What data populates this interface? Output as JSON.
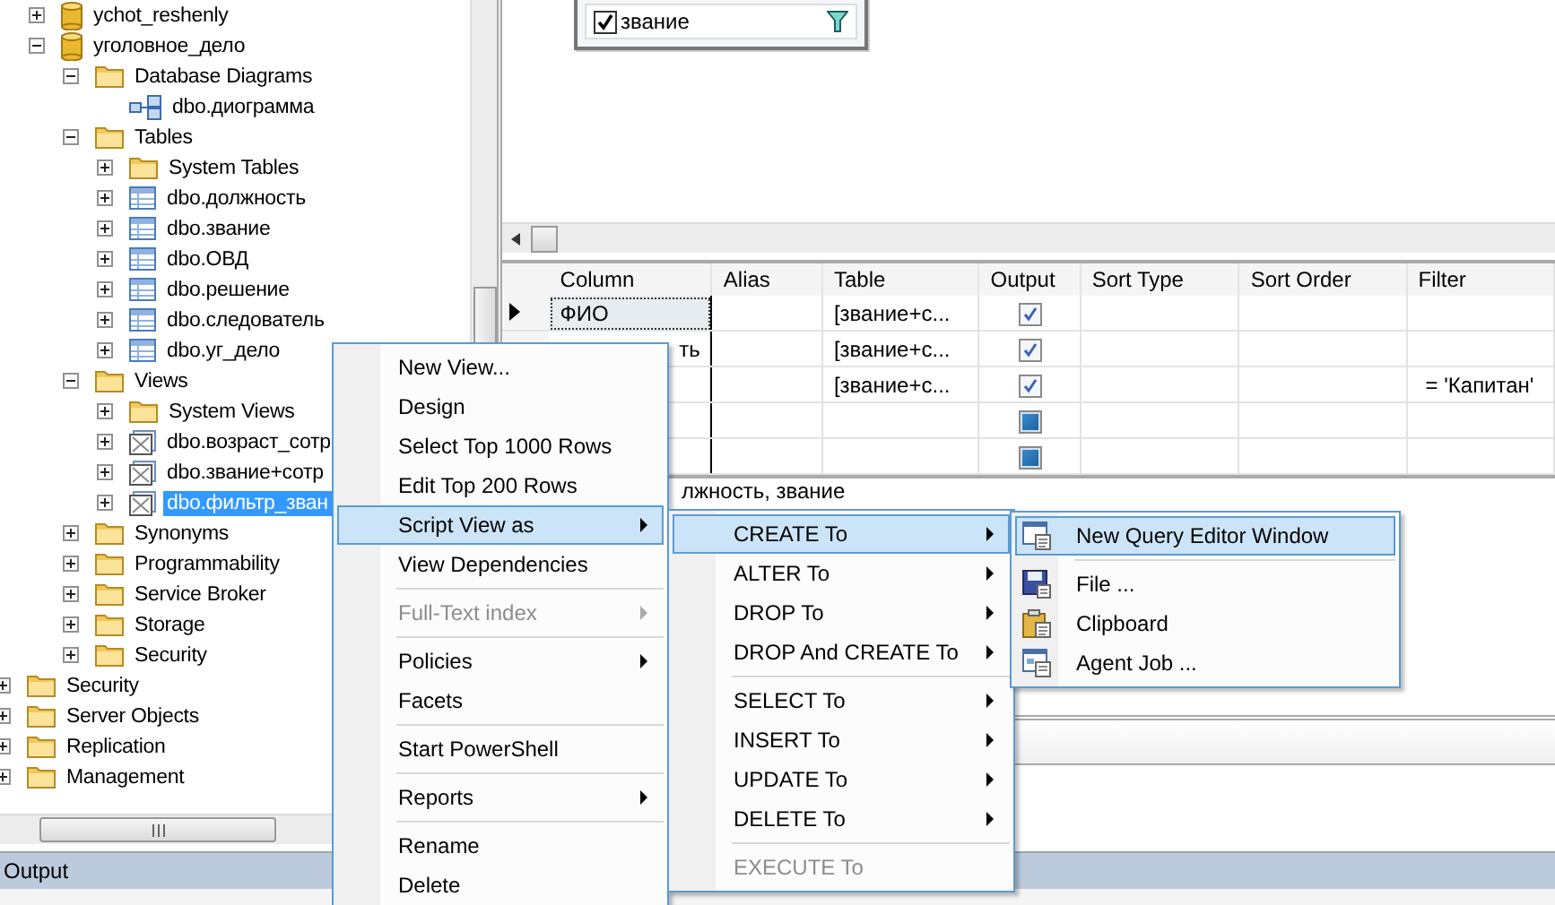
{
  "object_explorer": {
    "database_nodes": [
      {
        "label": "ychot_reshenly",
        "kind": "database",
        "expanded": false,
        "selected": false
      },
      {
        "label": "уголовное_дело",
        "kind": "database",
        "expanded": true,
        "selected": false,
        "children": [
          {
            "label": "Database Diagrams",
            "kind": "folder",
            "expanded": true,
            "selected": false,
            "children": [
              {
                "label": "dbo.диограмма",
                "kind": "diagram",
                "selected": false
              }
            ]
          },
          {
            "label": "Tables",
            "kind": "folder",
            "expanded": true,
            "selected": false,
            "children": [
              {
                "label": "System Tables",
                "kind": "folder",
                "expanded": false,
                "selected": false
              },
              {
                "label": "dbo.должность",
                "kind": "table",
                "expanded": false,
                "selected": false
              },
              {
                "label": "dbo.звание",
                "kind": "table",
                "expanded": false,
                "selected": false
              },
              {
                "label": "dbo.ОВД",
                "kind": "table",
                "expanded": false,
                "selected": false
              },
              {
                "label": "dbo.решение",
                "kind": "table",
                "expanded": false,
                "selected": false
              },
              {
                "label": "dbo.следователь",
                "kind": "table",
                "expanded": false,
                "selected": false
              },
              {
                "label": "dbo.уг_дело",
                "kind": "table",
                "expanded": false,
                "selected": false
              }
            ]
          },
          {
            "label": "Views",
            "kind": "folder",
            "expanded": true,
            "selected": false,
            "children": [
              {
                "label": "System Views",
                "kind": "folder",
                "expanded": false,
                "selected": false
              },
              {
                "label": "dbo.возраст_сотр",
                "kind": "view",
                "expanded": false,
                "selected": false
              },
              {
                "label": "dbo.звание+сотр",
                "kind": "view",
                "expanded": false,
                "selected": false
              },
              {
                "label": "dbo.фильтр_зван",
                "kind": "view",
                "expanded": false,
                "selected": true
              }
            ]
          },
          {
            "label": "Synonyms",
            "kind": "folder",
            "expanded": false,
            "selected": false
          },
          {
            "label": "Programmability",
            "kind": "folder",
            "expanded": false,
            "selected": false
          },
          {
            "label": "Service Broker",
            "kind": "folder",
            "expanded": false,
            "selected": false
          },
          {
            "label": "Storage",
            "kind": "folder",
            "expanded": false,
            "selected": false
          },
          {
            "label": "Security",
            "kind": "folder",
            "expanded": false,
            "selected": false
          }
        ]
      }
    ],
    "server_nodes": [
      {
        "label": "Security",
        "kind": "folder",
        "expanded": false,
        "selected": false
      },
      {
        "label": "Server Objects",
        "kind": "folder",
        "expanded": false,
        "selected": false
      },
      {
        "label": "Replication",
        "kind": "folder",
        "expanded": false,
        "selected": false
      },
      {
        "label": "Management",
        "kind": "folder",
        "expanded": false,
        "selected": false
      }
    ]
  },
  "diagram_table": {
    "fields": [
      {
        "label": "звание",
        "checked": true,
        "filtered": true
      }
    ]
  },
  "criteria_grid": {
    "columns": [
      "Column",
      "Alias",
      "Table",
      "Output",
      "Sort Type",
      "Sort Order",
      "Filter"
    ],
    "rows": [
      {
        "current": true,
        "column": "ФИО",
        "alias": "",
        "table": "[звание+с...",
        "output": true,
        "sort_type": "",
        "sort_order": "",
        "filter": ""
      },
      {
        "current": false,
        "column": "ть",
        "alias": "",
        "table": "[звание+с...",
        "output": true,
        "sort_type": "",
        "sort_order": "",
        "filter": ""
      },
      {
        "current": false,
        "column": "",
        "alias": "",
        "table": "[звание+с...",
        "output": true,
        "sort_type": "",
        "sort_order": "",
        "filter": "= 'Капитан'"
      },
      {
        "current": false,
        "column": "",
        "alias": "",
        "table": "",
        "output": false,
        "sort_type": "",
        "sort_order": "",
        "filter": ""
      },
      {
        "current": false,
        "column": "",
        "alias": "",
        "table": "",
        "output": false,
        "sort_type": "",
        "sort_order": "",
        "filter": ""
      }
    ]
  },
  "sql_pane": {
    "text": "лжность, звание"
  },
  "output_panel": {
    "title": "Output"
  },
  "context_menu": [
    {
      "kind": "item",
      "label": "New View...",
      "selected": false,
      "disabled": false,
      "submenu": false
    },
    {
      "kind": "item",
      "label": "Design",
      "selected": false,
      "disabled": false,
      "submenu": false
    },
    {
      "kind": "item",
      "label": "Select Top 1000 Rows",
      "selected": false,
      "disabled": false,
      "submenu": false
    },
    {
      "kind": "item",
      "label": "Edit Top 200 Rows",
      "selected": false,
      "disabled": false,
      "submenu": false
    },
    {
      "kind": "item",
      "label": "Script View as",
      "selected": true,
      "disabled": false,
      "submenu": true
    },
    {
      "kind": "item",
      "label": "View Dependencies",
      "selected": false,
      "disabled": false,
      "submenu": false
    },
    {
      "kind": "separator"
    },
    {
      "kind": "item",
      "label": "Full-Text index",
      "selected": false,
      "disabled": true,
      "submenu": true
    },
    {
      "kind": "separator"
    },
    {
      "kind": "item",
      "label": "Policies",
      "selected": false,
      "disabled": false,
      "submenu": true
    },
    {
      "kind": "item",
      "label": "Facets",
      "selected": false,
      "disabled": false,
      "submenu": false
    },
    {
      "kind": "separator"
    },
    {
      "kind": "item",
      "label": "Start PowerShell",
      "selected": false,
      "disabled": false,
      "submenu": false
    },
    {
      "kind": "separator"
    },
    {
      "kind": "item",
      "label": "Reports",
      "selected": false,
      "disabled": false,
      "submenu": true
    },
    {
      "kind": "separator"
    },
    {
      "kind": "item",
      "label": "Rename",
      "selected": false,
      "disabled": false,
      "submenu": false
    },
    {
      "kind": "item",
      "label": "Delete",
      "selected": false,
      "disabled": false,
      "submenu": false
    }
  ],
  "script_submenu": [
    {
      "kind": "item",
      "label": "CREATE To",
      "selected": true,
      "disabled": false,
      "submenu": true
    },
    {
      "kind": "item",
      "label": "ALTER To",
      "selected": false,
      "disabled": false,
      "submenu": true
    },
    {
      "kind": "item",
      "label": "DROP To",
      "selected": false,
      "disabled": false,
      "submenu": true
    },
    {
      "kind": "item",
      "label": "DROP And CREATE To",
      "selected": false,
      "disabled": false,
      "submenu": true
    },
    {
      "kind": "separator"
    },
    {
      "kind": "item",
      "label": "SELECT To",
      "selected": false,
      "disabled": false,
      "submenu": true
    },
    {
      "kind": "item",
      "label": "INSERT To",
      "selected": false,
      "disabled": false,
      "submenu": true
    },
    {
      "kind": "item",
      "label": "UPDATE To",
      "selected": false,
      "disabled": false,
      "submenu": true
    },
    {
      "kind": "item",
      "label": "DELETE To",
      "selected": false,
      "disabled": false,
      "submenu": true
    },
    {
      "kind": "separator"
    },
    {
      "kind": "item",
      "label": "EXECUTE To",
      "selected": false,
      "disabled": true,
      "submenu": false
    }
  ],
  "create_submenu": [
    {
      "kind": "item",
      "label": "New Query Editor Window",
      "selected": true,
      "disabled": false,
      "submenu": false
    },
    {
      "kind": "separator"
    },
    {
      "kind": "item",
      "label": "File ...",
      "selected": false,
      "disabled": false,
      "submenu": false
    },
    {
      "kind": "item",
      "label": "Clipboard",
      "selected": false,
      "disabled": false,
      "submenu": false
    },
    {
      "kind": "item",
      "label": "Agent Job ...",
      "selected": false,
      "disabled": false,
      "submenu": false
    }
  ]
}
